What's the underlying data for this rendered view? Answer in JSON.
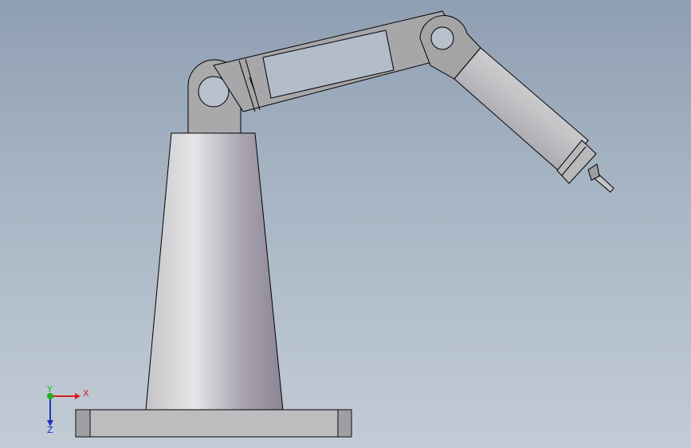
{
  "viewport": {
    "background_top": "#8f9fb2",
    "background_bottom": "#c2ccd6"
  },
  "triad": {
    "x_label": "X",
    "y_label": "Y",
    "z_label": "Z",
    "x_color": "#d32020",
    "y_color": "#20b020",
    "z_color": "#2030c0"
  },
  "model": {
    "icon": "robot-arm-model"
  }
}
